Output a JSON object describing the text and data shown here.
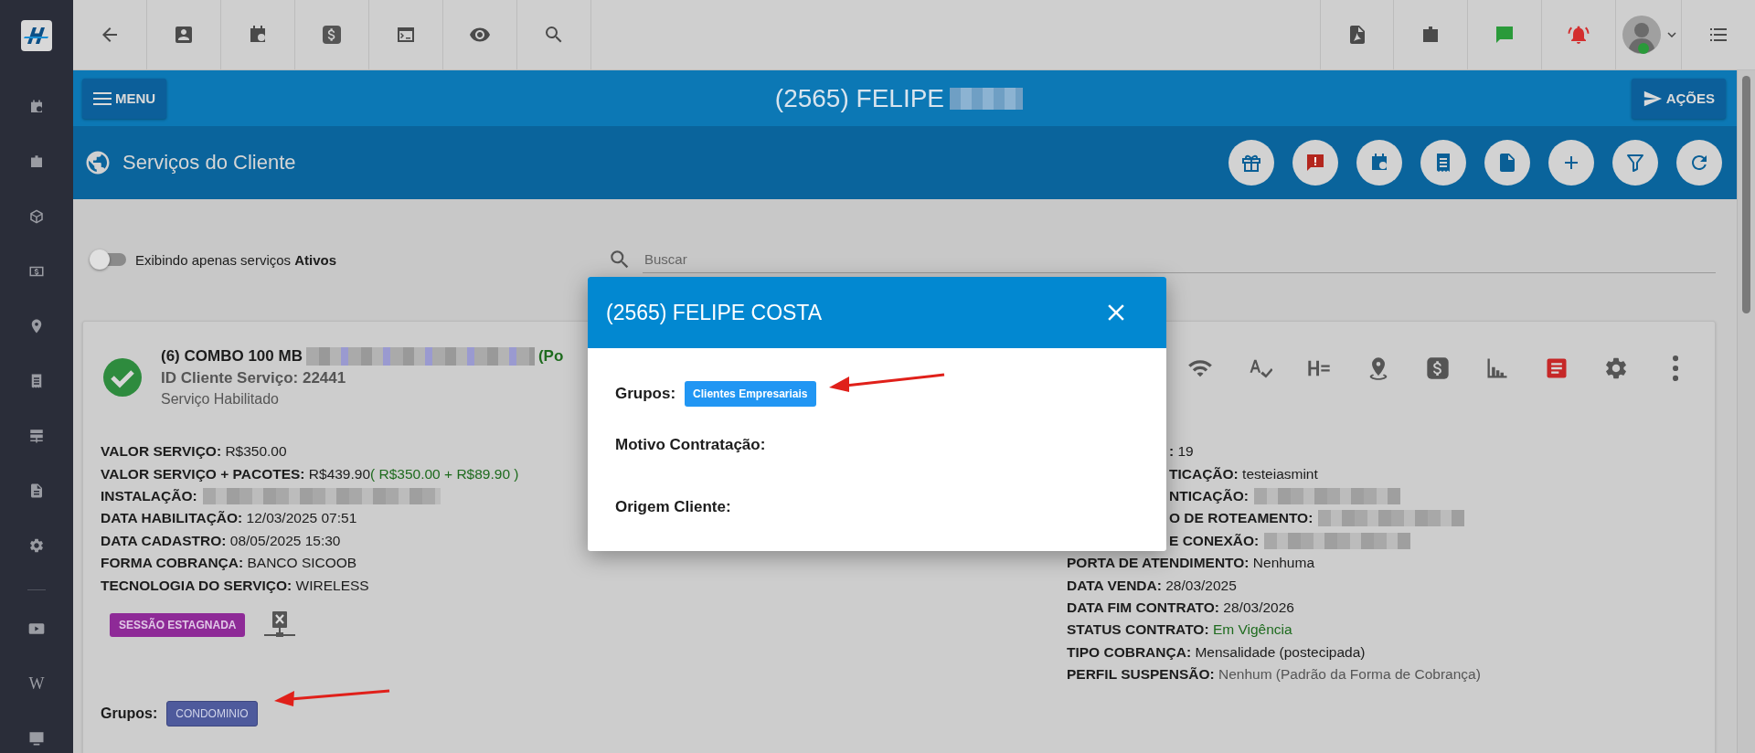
{
  "header": {
    "title": "(2565) FELIPE",
    "menu_button": "MENU",
    "actions_button": "AÇÕES"
  },
  "section": {
    "title": "Serviços do Cliente"
  },
  "filter": {
    "on": false,
    "label": "Exibindo apenas serviços **Ativos**"
  },
  "search": {
    "placeholder": "Buscar"
  },
  "sidebar": {
    "link_label": "W"
  },
  "service": {
    "title": "(6) COMBO 100 MB",
    "title_suffix": "(Po",
    "client_id": "ID Cliente Serviço: 22441",
    "status": "Serviço Habilitado",
    "left_fields": [
      {
        "label": "VALOR SERVIÇO:",
        "value": "R$350.00",
        "kind": "plain"
      },
      {
        "label": "VALOR SERVIÇO + PACOTES:",
        "value": "R$439.90",
        "note": "( R$350.00 + R$89.90 )",
        "kind": "plain"
      },
      {
        "label": "INSTALAÇÃO:",
        "kind": "redacted"
      },
      {
        "label": "DATA HABILITAÇÃO:",
        "value": "12/03/2025 07:51",
        "kind": "plain"
      },
      {
        "label": "DATA CADASTRO:",
        "value": "08/05/2025 15:30",
        "kind": "plain"
      },
      {
        "label": "FORMA COBRANÇA:",
        "value": "BANCO SICOOB",
        "kind": "plain"
      },
      {
        "label": "TECNOLOGIA DO SERVIÇO:",
        "value": "WIRELESS",
        "kind": "plain"
      }
    ],
    "right_fields_partly_hidden": [
      {
        "label": ":",
        "value": "19",
        "kind": "plain"
      },
      {
        "label": "TICAÇÃO:",
        "value": "testeiasmint",
        "kind": "plain"
      },
      {
        "label": "NTICAÇÃO:",
        "kind": "redacted"
      },
      {
        "label": "O DE ROTEAMENTO:",
        "kind": "redacted"
      },
      {
        "label": "E CONEXÃO:",
        "kind": "redacted"
      }
    ],
    "right_fields": [
      {
        "label": "PORTA DE ATENDIMENTO:",
        "value": "Nenhuma",
        "kind": "plain"
      },
      {
        "label": "DATA VENDA:",
        "value": "28/03/2025",
        "kind": "plain"
      },
      {
        "label": "DATA FIM CONTRATO:",
        "value": "28/03/2026",
        "kind": "plain"
      },
      {
        "label": "STATUS CONTRATO:",
        "value": "Em Vigência",
        "kind": "success"
      },
      {
        "label": "TIPO COBRANÇA:",
        "value": "Mensalidade (postecipada)",
        "kind": "plain"
      },
      {
        "label": "PERFIL SUSPENSÃO:",
        "value": "Nenhum (Padrão da Forma de Cobrança)",
        "kind": "muted"
      }
    ],
    "session_badge": "SESSÃO ESTAGNADA",
    "groups_label": "Grupos:",
    "groups": [
      "CONDOMINIO"
    ]
  },
  "modal": {
    "title": "(2565) FELIPE COSTA",
    "fields": [
      {
        "label": "Grupos:",
        "tags": [
          "Clientes Empresariais"
        ]
      },
      {
        "label": "Motivo Contratação:"
      },
      {
        "label": "Origem Cliente:"
      }
    ]
  }
}
